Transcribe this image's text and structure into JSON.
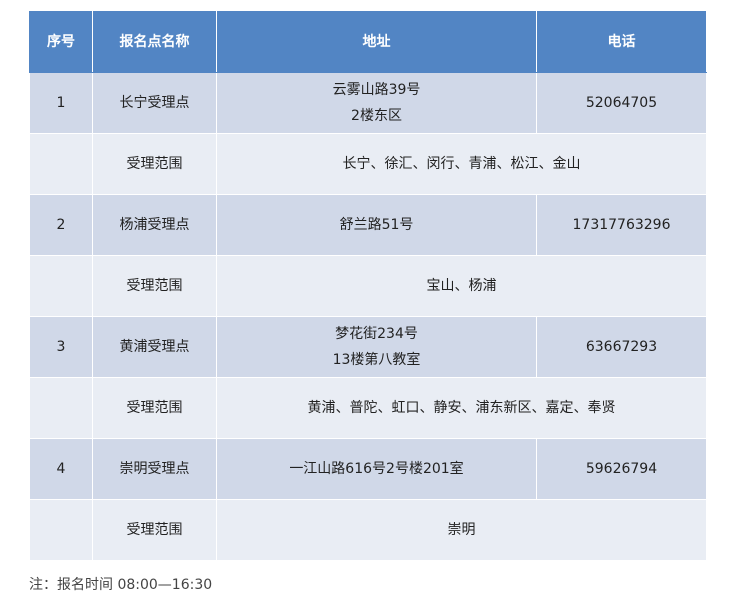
{
  "table": {
    "headers": {
      "index": "序号",
      "name": "报名点名称",
      "address": "地址",
      "phone": "电话"
    },
    "scope_label": "受理范围",
    "rows": [
      {
        "index": "1",
        "name": "长宁受理点",
        "address_lines": [
          "云雾山路39号",
          "2楼东区"
        ],
        "phone": "52064705",
        "scope": "长宁、徐汇、闵行、青浦、松江、金山"
      },
      {
        "index": "2",
        "name": "杨浦受理点",
        "address_lines": [
          "舒兰路51号"
        ],
        "phone": "17317763296",
        "scope": "宝山、杨浦"
      },
      {
        "index": "3",
        "name": "黄浦受理点",
        "address_lines": [
          "梦花街234号",
          "13楼第八教室"
        ],
        "phone": "63667293",
        "scope": "黄浦、普陀、虹口、静安、浦东新区、嘉定、奉贤"
      },
      {
        "index": "4",
        "name": "崇明受理点",
        "address_lines": [
          "一江山路616号2号楼201室"
        ],
        "phone": "59626794",
        "scope": "崇明"
      }
    ]
  },
  "note": "注：报名时间 08:00—16:30",
  "colors": {
    "header_bg": "#5285c4",
    "main_row_bg": "#d0d8e8",
    "scope_row_bg": "#e9edf4"
  }
}
